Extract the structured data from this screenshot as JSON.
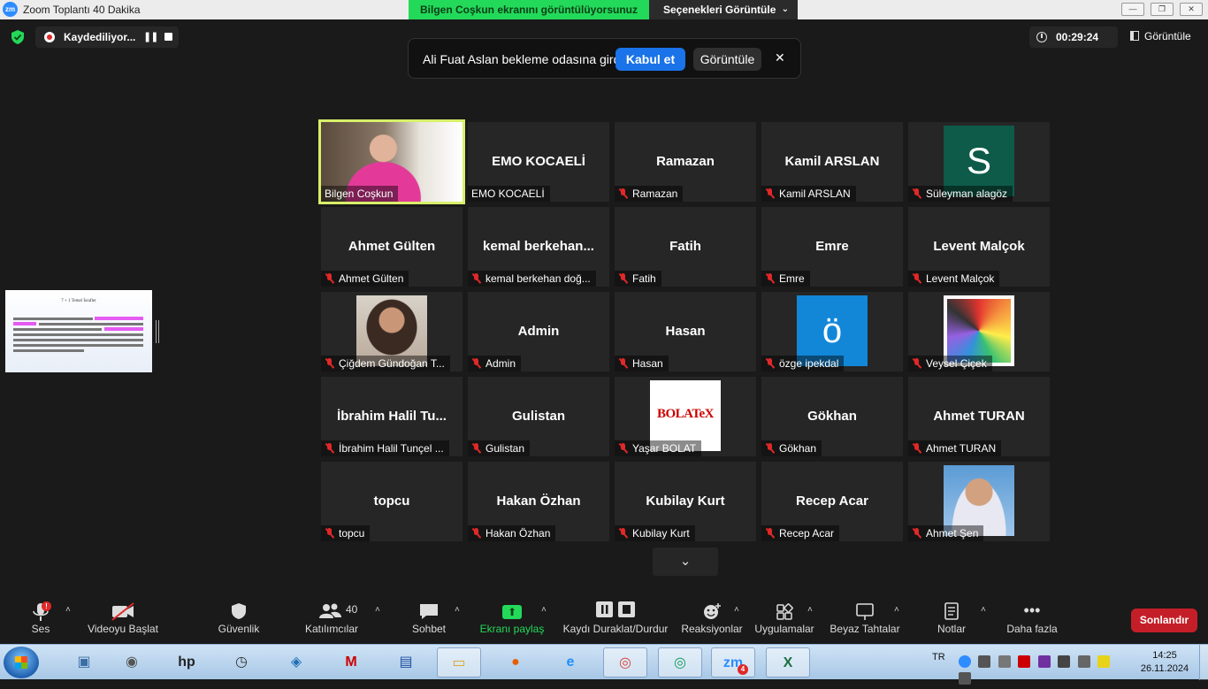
{
  "titlebar": {
    "app_icon": "zm",
    "title": "Zoom Toplantı 40 Dakika",
    "share_banner": "Bilgen Coşkun ekranını görüntülüyorsunuz",
    "options": "Seçenekleri Görüntüle",
    "min": "—",
    "max": "❐",
    "close": "✕"
  },
  "topbar": {
    "recording": "Kaydediliyor...",
    "pause_glyph": "❚❚",
    "timer": "00:29:24",
    "view": "Görüntüle"
  },
  "notification": {
    "text": "Ali Fuat Aslan bekleme odasına girdi",
    "accept": "Kabul et",
    "view": "Görüntüle",
    "close": "✕"
  },
  "shared_screen": {
    "doc_title": "7 + 1 Temel İsrafler"
  },
  "participants": [
    {
      "name": "Bilgen Coşkun",
      "display": "",
      "muted": false,
      "kind": "video"
    },
    {
      "name": "EMO KOCAELİ",
      "display": "EMO KOCAELİ",
      "muted": false,
      "kind": "name"
    },
    {
      "name": "Ramazan",
      "display": "Ramazan",
      "muted": true,
      "kind": "name"
    },
    {
      "name": "Kamil ARSLAN",
      "display": "Kamil ARSLAN",
      "muted": true,
      "kind": "name"
    },
    {
      "name": "Süleyman alagöz",
      "display": "S",
      "muted": true,
      "kind": "avatar-s"
    },
    {
      "name": "Ahmet Gülten",
      "display": "Ahmet Gülten",
      "muted": true,
      "kind": "name"
    },
    {
      "name": "kemal berkehan doğ...",
      "display": "kemal  berkehan...",
      "muted": true,
      "kind": "name"
    },
    {
      "name": "Fatih",
      "display": "Fatih",
      "muted": true,
      "kind": "name"
    },
    {
      "name": "Emre",
      "display": "Emre",
      "muted": true,
      "kind": "name"
    },
    {
      "name": "Levent Malçok",
      "display": "Levent Malçok",
      "muted": true,
      "kind": "name"
    },
    {
      "name": "Çiğdem Gündoğan T...",
      "display": "",
      "muted": true,
      "kind": "photo-woman"
    },
    {
      "name": "Admin",
      "display": "Admin",
      "muted": true,
      "kind": "name"
    },
    {
      "name": "Hasan",
      "display": "Hasan",
      "muted": true,
      "kind": "name"
    },
    {
      "name": "özge ipekdal",
      "display": "ö",
      "muted": true,
      "kind": "avatar-o"
    },
    {
      "name": "Veysel Çiçek",
      "display": "",
      "muted": true,
      "kind": "photo-brain"
    },
    {
      "name": "İbrahim Halil Tunçel ...",
      "display": "İbrahim  Halil Tu...",
      "muted": true,
      "kind": "name"
    },
    {
      "name": "Gulistan",
      "display": "Gulistan",
      "muted": true,
      "kind": "name"
    },
    {
      "name": "Yaşar BOLAT",
      "display": "BOLATeX",
      "muted": true,
      "kind": "logo-bolat"
    },
    {
      "name": "Gökhan",
      "display": "Gökhan",
      "muted": true,
      "kind": "name"
    },
    {
      "name": "Ahmet TURAN",
      "display": "Ahmet TURAN",
      "muted": true,
      "kind": "name"
    },
    {
      "name": "topcu",
      "display": "topcu",
      "muted": true,
      "kind": "name"
    },
    {
      "name": "Hakan Özhan",
      "display": "Hakan Özhan",
      "muted": true,
      "kind": "name"
    },
    {
      "name": "Kubilay Kurt",
      "display": "Kubilay Kurt",
      "muted": true,
      "kind": "name"
    },
    {
      "name": "Recep Acar",
      "display": "Recep Acar",
      "muted": true,
      "kind": "name"
    },
    {
      "name": "Ahmet Şen",
      "display": "",
      "muted": true,
      "kind": "photo-man"
    }
  ],
  "scroll_down": "⌄",
  "toolbar": {
    "audio": "Ses",
    "audio_badge": "!",
    "video": "Videoyu Başlat",
    "security": "Güvenlik",
    "participants": "Katılımcılar",
    "participants_count": "40",
    "chat": "Sohbet",
    "share": "Ekranı paylaş",
    "share_glyph": "⬆",
    "record": "Kaydı Duraklat/Durdur",
    "reactions": "Reaksiyonlar",
    "apps": "Uygulamalar",
    "whiteboards": "Beyaz Tahtalar",
    "notes": "Notlar",
    "more": "Daha fazla",
    "more_glyph": "•••",
    "caret": "˄",
    "end": "Sonlandır"
  },
  "taskbar": {
    "apps": [
      {
        "icon": "security-shield-app-icon",
        "glyph": "▣",
        "color": "#3a6ea5"
      },
      {
        "icon": "media-player-icon",
        "glyph": "◉",
        "color": "#555"
      },
      {
        "icon": "hp-icon",
        "glyph": "hp",
        "color": "#222"
      },
      {
        "icon": "clock-app-icon",
        "glyph": "◷",
        "color": "#333"
      },
      {
        "icon": "network-app-icon",
        "glyph": "◈",
        "color": "#1f6fb5"
      },
      {
        "icon": "mcafee-icon",
        "glyph": "M",
        "color": "#c00"
      },
      {
        "icon": "scanner-icon",
        "glyph": "▤",
        "color": "#1f4fa0"
      },
      {
        "icon": "folder-icon",
        "glyph": "▭",
        "color": "#d9a520"
      },
      {
        "icon": "firefox-icon",
        "glyph": "●",
        "color": "#e66000"
      },
      {
        "icon": "ie-icon",
        "glyph": "e",
        "color": "#1e90ff"
      },
      {
        "icon": "chrome-icon",
        "glyph": "◎",
        "color": "#db4437"
      },
      {
        "icon": "chrome-profile-icon",
        "glyph": "◎",
        "color": "#0f9d58"
      },
      {
        "icon": "zoom-taskbar-icon",
        "glyph": "zm",
        "color": "#2d8cff"
      },
      {
        "icon": "excel-icon",
        "glyph": "X",
        "color": "#1d6f42"
      }
    ],
    "lang": "TR",
    "time": "14:25",
    "date": "26.11.2024",
    "zoom_badge": "4"
  }
}
